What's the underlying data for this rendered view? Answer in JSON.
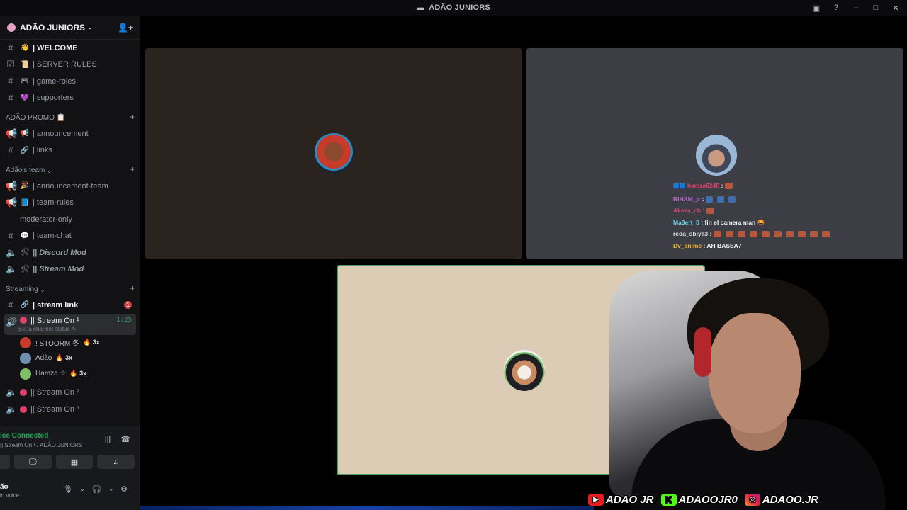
{
  "window": {
    "title": "ADÃO JUNIORS"
  },
  "server": {
    "name": "ADÃO JUNIORS"
  },
  "channels_top": [
    {
      "emoji": "👋",
      "name": "| WELCOME",
      "bold": true,
      "type": "text"
    },
    {
      "emoji": "📜",
      "name": "| SERVER RULES",
      "bold": false,
      "type": "rules"
    },
    {
      "emoji": "🎮",
      "name": "| game-roles",
      "bold": false,
      "type": "text"
    },
    {
      "emoji": "💜",
      "name": "| supporters",
      "bold": false,
      "type": "text"
    }
  ],
  "category_promo": {
    "name": "ADÃO PROMO 📋"
  },
  "channels_promo": [
    {
      "emoji": "📢",
      "name": "| announcement",
      "type": "announce"
    },
    {
      "emoji": "🔗",
      "name": "| links",
      "type": "text"
    }
  ],
  "category_team": {
    "name": "Adão's team"
  },
  "channels_team": [
    {
      "emoji": "🎉",
      "name": "| announcement-team",
      "type": "announce"
    },
    {
      "emoji": "📘",
      "name": "| team-rules",
      "type": "announce"
    },
    {
      "emoji": "",
      "name": "moderator-only",
      "type": "text"
    },
    {
      "emoji": "💬",
      "name": "| team-chat",
      "type": "text"
    },
    {
      "emoji": "🛠",
      "name": "|| Discord Mod",
      "type": "voice"
    },
    {
      "emoji": "🛠",
      "name": "|| Stream Mod",
      "type": "voice"
    }
  ],
  "category_streaming": {
    "name": "Streaming"
  },
  "stream_link": {
    "emoji": "🔗",
    "name": "| stream link",
    "badge": "1"
  },
  "active_voice": {
    "name": "|| Stream On ¹",
    "timer": "1:25",
    "status": "Set a channel status ✎"
  },
  "members": [
    {
      "name": "! STOORM 冬",
      "tag": "🔥 3x",
      "color": "#c83a2a"
    },
    {
      "name": "Adão",
      "tag": "🔥 3x",
      "color": "#6f8fb0"
    },
    {
      "name": "Hamza.☆",
      "tag": "🔥 3x",
      "color": "#7fbf6a"
    }
  ],
  "voice_after": [
    {
      "name": "|| Stream On ²"
    },
    {
      "name": "|| Stream On ³"
    }
  ],
  "voice_panel": {
    "status": "ice Connected",
    "sub": "|| Stream On ¹ / ADÃO JUNIORS",
    "username": "ão",
    "user_sub": "in voice"
  },
  "chat": [
    {
      "user": "hamza6249",
      "color": "#e0426e",
      "msg": ":",
      "emotes": 1,
      "prefix": "🟦🟦"
    },
    {
      "user": "RIHAM_jr",
      "color": "#c06ad8",
      "msg": ":",
      "emotes": 3,
      "blue": true
    },
    {
      "user": "Akaza_ch",
      "color": "#e0426e",
      "msg": ":",
      "emotes": 1
    },
    {
      "user": "Ma3ert_0",
      "color": "#6fd0e8",
      "msg": ": fin el camera man 🤬",
      "emotes": 0
    },
    {
      "user": "reda_sbiya3",
      "color": "#dbdee1",
      "msg": ":",
      "emotes": 10
    },
    {
      "user": "Dv_anime",
      "color": "#f0b232",
      "msg": ": AH BASSA7",
      "emotes": 0
    }
  ],
  "socials": [
    {
      "icon": "youtube-icon",
      "label": "ADAO JR"
    },
    {
      "icon": "kick-icon",
      "label": "ADAOOJR0"
    },
    {
      "icon": "instagram-icon",
      "label": "ADAOO.JR"
    }
  ],
  "colors": {
    "accent_green": "#23a55a",
    "badge_red": "#da373c",
    "tile_border": "#4e9d66"
  }
}
